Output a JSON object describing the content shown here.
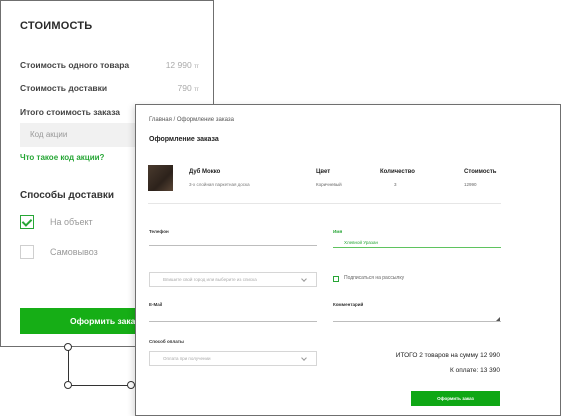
{
  "cart": {
    "title": "СТОИМОСТЬ",
    "rows": [
      {
        "label": "Стоимость одного товара",
        "value": "12 990",
        "currency": "тг"
      },
      {
        "label": "Стоимость доставки",
        "value": "790",
        "currency": "тг"
      },
      {
        "label": "Итого стоимость заказа"
      }
    ],
    "promo_placeholder": "Код акции",
    "promo_link": "Что такое код акции?",
    "delivery_title": "Способы доставки",
    "delivery_options": [
      {
        "label": "На объект",
        "checked": true
      },
      {
        "label": "Самовывоз",
        "checked": false
      }
    ],
    "submit_label": "Оформить заказ"
  },
  "order": {
    "breadcrumb": "Главная / Оформление заказа",
    "title": "Оформление заказа",
    "product": {
      "name": "Дуб Мокко",
      "desc": "3-х слойная паркетная доска",
      "headers": {
        "color": "Цвет",
        "qty": "Количество",
        "price": "Стоимость"
      },
      "color": "Коричневый",
      "qty": "3",
      "price": "12990"
    },
    "fields": {
      "phone_label": "Телефон",
      "name_label": "Имя",
      "name_value": "Хлевной Уразан",
      "city_placeholder": "Впишите свой город или выберите из списка",
      "subscribe_label": "Подписаться на рассылку",
      "email_label": "E-Mail",
      "comment_label": "Комментарий",
      "payment_label": "Способ оплаты",
      "payment_placeholder": "Оплата при получении"
    },
    "total_line": "ИТОГО 2 товаров на сумму 12 990",
    "pay_line": "К оплате: 13 390",
    "submit_label": "Оформить заказ"
  },
  "colors": {
    "accent": "#16ae16",
    "link": "#27a636"
  }
}
